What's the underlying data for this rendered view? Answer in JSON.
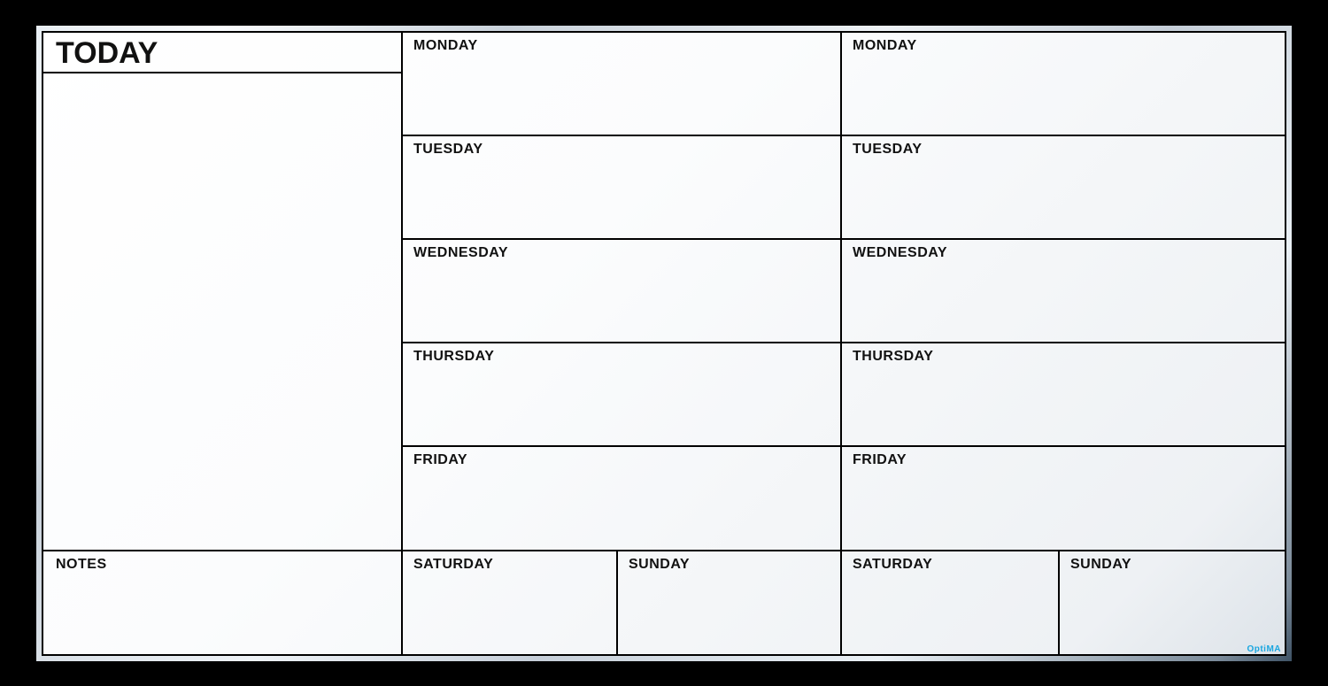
{
  "left": {
    "today": "TODAY",
    "notes": "NOTES"
  },
  "week1": {
    "mon": "MONDAY",
    "tue": "TUESDAY",
    "wed": "WEDNESDAY",
    "thu": "THURSDAY",
    "fri": "FRIDAY",
    "sat": "SATURDAY",
    "sun": "SUNDAY"
  },
  "week2": {
    "mon": "MONDAY",
    "tue": "TUESDAY",
    "wed": "WEDNESDAY",
    "thu": "THURSDAY",
    "fri": "FRIDAY",
    "sat": "SATURDAY",
    "sun": "SUNDAY"
  },
  "brand": "OptiMA"
}
